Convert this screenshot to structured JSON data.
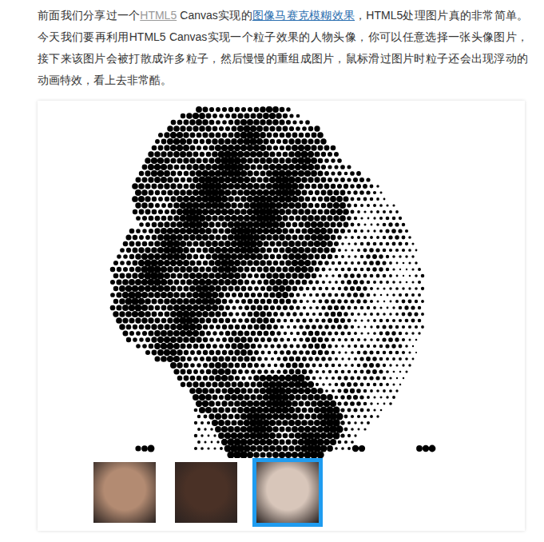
{
  "article": {
    "paragraph": [
      {
        "text": "前面我们分享过一个",
        "kind": "plain"
      },
      {
        "text": "HTML5",
        "kind": "tag-link"
      },
      {
        "text": " Canvas实现的",
        "kind": "plain"
      },
      {
        "text": "图像马赛克模糊效果",
        "kind": "link"
      },
      {
        "text": "，HTML5处理图片真的非常简单。今天我们要再利用HTML5 Canvas实现一个粒子效果的人物头像，你可以任意选择一张头像图片，接下来该图片会被打散成许多粒子，然后慢慢的重组成图片，鼠标滑过图片时粒子还会出现浮动的动画特效，看上去非常酷。",
        "kind": "plain"
      }
    ]
  },
  "demo": {
    "thumbnails": [
      {
        "selected": false,
        "color": "#b38b72"
      },
      {
        "selected": false,
        "color": "#4a3126"
      },
      {
        "selected": true,
        "color": "#d8c6ba"
      }
    ]
  }
}
